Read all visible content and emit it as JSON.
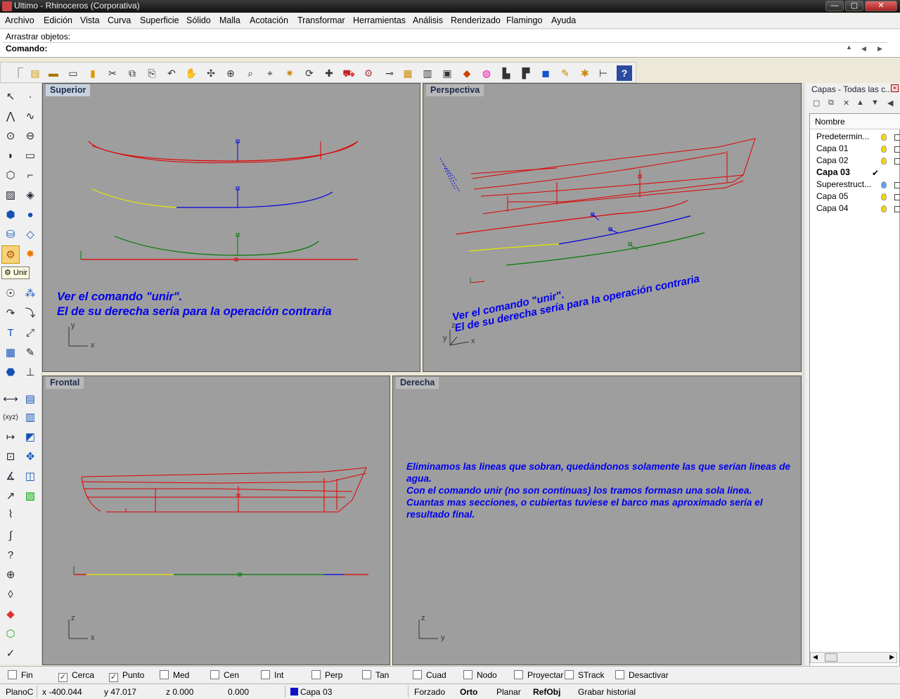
{
  "window": {
    "title": "Ultimo - Rhinoceros (Corporativa)",
    "btn_min": "—",
    "btn_max": "▢",
    "btn_close": "✕"
  },
  "menu": [
    "Archivo",
    "Edición",
    "Vista",
    "Curva",
    "Superficie",
    "Sólido",
    "Malla",
    "Acotación",
    "Transformar",
    "Herramientas",
    "Análisis",
    "Renderizado",
    "Flamingo",
    "Ayuda"
  ],
  "command": {
    "history": "Arrastrar objetos:",
    "prompt": "Comando:",
    "value": ""
  },
  "tooltip": "Unir",
  "viewports": {
    "top": "Superior",
    "persp": "Perspectiva",
    "front": "Frontal",
    "right": "Derecha"
  },
  "axes": {
    "x": "x",
    "y": "y",
    "z": "z"
  },
  "notes": {
    "top_line1": "Ver el comando \"unir\".",
    "top_line2": "El de su derecha sería para la operación contraria",
    "persp_line1": "Ver el comando \"unir\".",
    "persp_line2": "El de su derecha sería para la operación contraria",
    "right_text": "Eliminamos las lineas que sobran, quedándonos solamente las que serian lineas de agua.\nCon el comando unir (no son continuas) los tramos formasn una sola linea.\nCuantas mas secciones, o cubiertas tuviese el barco mas aproximado sería el resultado final."
  },
  "layers": {
    "title": "Capas - Todas las c...",
    "column": "Nombre",
    "current_mark": "✔",
    "items": [
      {
        "name": "Predetermin...",
        "bulb": "#f5d800"
      },
      {
        "name": "Capa 01",
        "bulb": "#f5d800"
      },
      {
        "name": "Capa 02",
        "bulb": "#f5d800"
      },
      {
        "name": "Capa 03",
        "bulb": "",
        "current": true
      },
      {
        "name": "Superestruct...",
        "bulb": "#5aa0ff"
      },
      {
        "name": "Capa 05",
        "bulb": "#f5d800"
      },
      {
        "name": "Capa 04",
        "bulb": "#f5d800"
      }
    ]
  },
  "osnaps": [
    {
      "label": "Fin",
      "checked": false
    },
    {
      "label": "Cerca",
      "checked": true
    },
    {
      "label": "Punto",
      "checked": true
    },
    {
      "label": "Med",
      "checked": false
    },
    {
      "label": "Cen",
      "checked": false
    },
    {
      "label": "Int",
      "checked": false
    },
    {
      "label": "Perp",
      "checked": false
    },
    {
      "label": "Tan",
      "checked": false
    },
    {
      "label": "Cuad",
      "checked": false
    },
    {
      "label": "Nodo",
      "checked": false
    },
    {
      "label": "Proyectar",
      "checked": false
    },
    {
      "label": "STrack",
      "checked": false
    },
    {
      "label": "Desactivar",
      "checked": false
    }
  ],
  "status": {
    "cplane": "PlanoC",
    "x": "x -400.044",
    "y": "y 47.017",
    "z": "z 0.000",
    "dist": "0.000",
    "layer": "Capa 03",
    "layer_color": "#1010c8",
    "forzado": "Forzado",
    "orto": "Orto",
    "planar": "Planar",
    "refobj": "RefObj",
    "history": "Grabar historial"
  },
  "colors": {
    "curve_red": "#e00000",
    "curve_blue": "#0000dd",
    "curve_green": "#007a00",
    "curve_yellow": "#e8e800",
    "viewport_bg": "#9e9e9e",
    "note_blue": "#0000ee"
  }
}
